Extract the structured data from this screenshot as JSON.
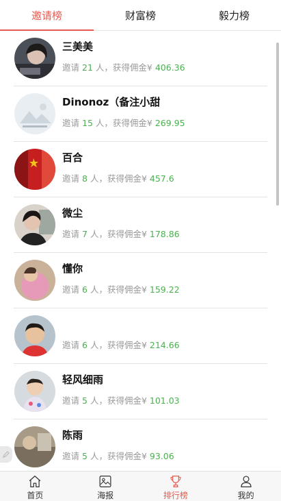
{
  "tabs": [
    {
      "label": "邀请榜",
      "active": true
    },
    {
      "label": "财富榜",
      "active": false
    },
    {
      "label": "毅力榜",
      "active": false
    }
  ],
  "stat_labels": {
    "invite": "邀请",
    "people": "人，获得佣金¥"
  },
  "items": [
    {
      "name": "三美美",
      "count": "21",
      "amount": "406.36",
      "avatar": "avatar-girl-dark"
    },
    {
      "name": "Dinonoz（备注小甜",
      "count": "15",
      "amount": "269.95",
      "avatar": "avatar-placeholder"
    },
    {
      "name": "百合",
      "count": "8",
      "amount": "457.6",
      "avatar": "avatar-flag-red"
    },
    {
      "name": "微尘",
      "count": "7",
      "amount": "178.86",
      "avatar": "avatar-woman"
    },
    {
      "name": "懂你",
      "count": "6",
      "amount": "159.22",
      "avatar": "avatar-pink"
    },
    {
      "name": "",
      "count": "6",
      "amount": "214.66",
      "avatar": "avatar-boy"
    },
    {
      "name": "轻风细雨",
      "count": "5",
      "amount": "101.03",
      "avatar": "avatar-child"
    },
    {
      "name": "陈雨",
      "count": "5",
      "amount": "93.06",
      "avatar": "avatar-misc"
    }
  ],
  "bottom_nav": [
    {
      "label": "首页",
      "icon": "home-icon",
      "active": false
    },
    {
      "label": "海报",
      "icon": "poster-icon",
      "active": false
    },
    {
      "label": "排行榜",
      "icon": "trophy-icon",
      "active": true
    },
    {
      "label": "我的",
      "icon": "user-icon",
      "active": false
    }
  ],
  "colors": {
    "accent": "#e65a50",
    "money": "#4caf50",
    "muted": "#9a9a9a"
  }
}
